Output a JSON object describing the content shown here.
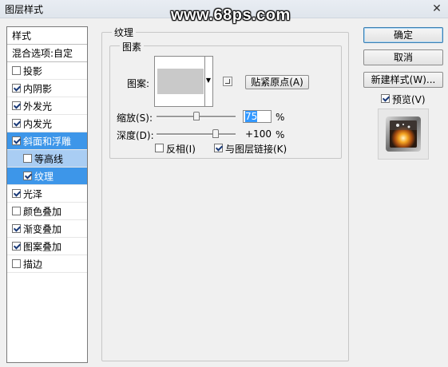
{
  "window": {
    "title": "图层样式",
    "close_symbol": "✕"
  },
  "watermark": "www.68ps.com",
  "sidebar": {
    "header": "样式",
    "blend_options": "混合选项:自定",
    "items": [
      {
        "label": "投影",
        "checked": false
      },
      {
        "label": "内阴影",
        "checked": true
      },
      {
        "label": "外发光",
        "checked": true
      },
      {
        "label": "内发光",
        "checked": true
      },
      {
        "label": "斜面和浮雕",
        "checked": true,
        "state": "selected-parent"
      },
      {
        "label": "等高线",
        "checked": false,
        "state": "sub"
      },
      {
        "label": "纹理",
        "checked": true,
        "state": "selected"
      },
      {
        "label": "光泽",
        "checked": true
      },
      {
        "label": "颜色叠加",
        "checked": false
      },
      {
        "label": "渐变叠加",
        "checked": true
      },
      {
        "label": "图案叠加",
        "checked": true
      },
      {
        "label": "描边",
        "checked": false
      }
    ]
  },
  "texture_panel": {
    "group_title": "纹理",
    "subgroup_title": "图素",
    "pattern_label": "图案:",
    "snap_origin_button": "贴紧原点(A)",
    "scale": {
      "label": "缩放(S):",
      "value": "75",
      "unit": "%",
      "level": 0.5
    },
    "depth": {
      "label": "深度(D):",
      "value": "+100",
      "unit": "%",
      "level": 0.75
    },
    "invert": {
      "label": "反相(I)",
      "checked": false
    },
    "link_with_layer": {
      "label": "与图层链接(K)",
      "checked": true
    }
  },
  "right_panel": {
    "ok_button": "确定",
    "cancel_button": "取消",
    "new_style_button": "新建样式(W)...",
    "preview": {
      "label": "预览(V)",
      "checked": true
    }
  },
  "colors": {
    "selection_dark": "#3d96e9",
    "selection_light": "#a9cdf3",
    "dialog_bg": "#f0f0f0"
  }
}
